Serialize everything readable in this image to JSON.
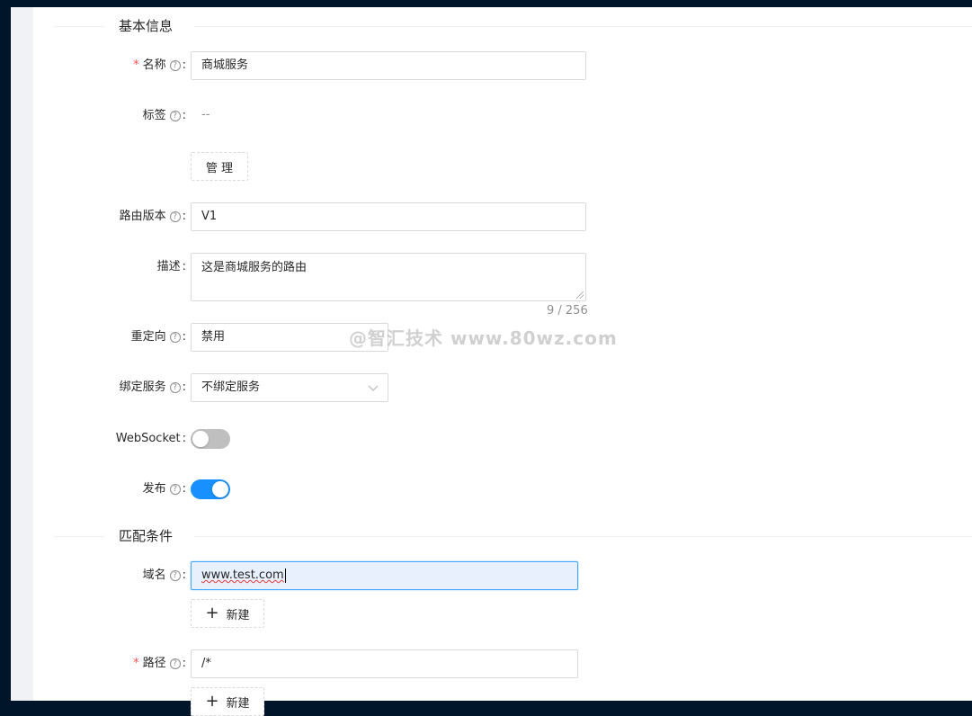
{
  "sections": {
    "basic_info": "基本信息",
    "match_conditions": "匹配条件"
  },
  "fields": {
    "name": {
      "label": "名称",
      "value": "商城服务",
      "required": true
    },
    "tags": {
      "label": "标签",
      "value": "--",
      "manage_button": "管 理"
    },
    "route_version": {
      "label": "路由版本",
      "value": "V1"
    },
    "description": {
      "label": "描述",
      "value": "这是商城服务的路由",
      "count": "9 / 256"
    },
    "redirect": {
      "label": "重定向",
      "value": "禁用"
    },
    "bind_service": {
      "label": "绑定服务",
      "value": "不绑定服务"
    },
    "websocket": {
      "label": "WebSocket",
      "enabled": false
    },
    "publish": {
      "label": "发布",
      "enabled": true
    },
    "domain": {
      "label": "域名",
      "value": "www.test.com",
      "new_button": "新建"
    },
    "path": {
      "label": "路径",
      "value": "/*",
      "required": true,
      "new_button": "新建"
    }
  },
  "help_glyph": "?",
  "colon": ":",
  "required_mark": "*",
  "plus_glyph": "+",
  "watermark": "@智汇技术 www.80wz.com",
  "colors": {
    "primary": "#1890ff",
    "nav_bg": "#001529",
    "required": "#ff4d4f"
  }
}
